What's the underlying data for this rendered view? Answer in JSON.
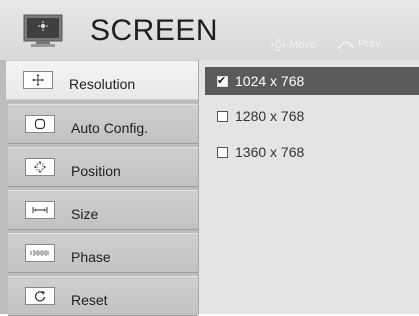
{
  "header": {
    "title": "SCREEN",
    "hints": {
      "move": "Move",
      "prev": "Prev."
    }
  },
  "menu": {
    "items": [
      {
        "label": "Resolution",
        "selected": true
      },
      {
        "label": "Auto Config.",
        "selected": false
      },
      {
        "label": "Position",
        "selected": false
      },
      {
        "label": "Size",
        "selected": false
      },
      {
        "label": "Phase",
        "selected": false
      },
      {
        "label": "Reset",
        "selected": false
      }
    ]
  },
  "options": {
    "items": [
      {
        "label": "1024 x 768",
        "checked": true,
        "selected": true
      },
      {
        "label": "1280 x 768",
        "checked": false,
        "selected": false
      },
      {
        "label": "1360 x 768",
        "checked": false,
        "selected": false
      }
    ]
  },
  "colors": {
    "selected_option_bg": "#5a5a5a",
    "menu_bg": "#bdbdbd",
    "panel_bg": "#e4e4e4"
  }
}
